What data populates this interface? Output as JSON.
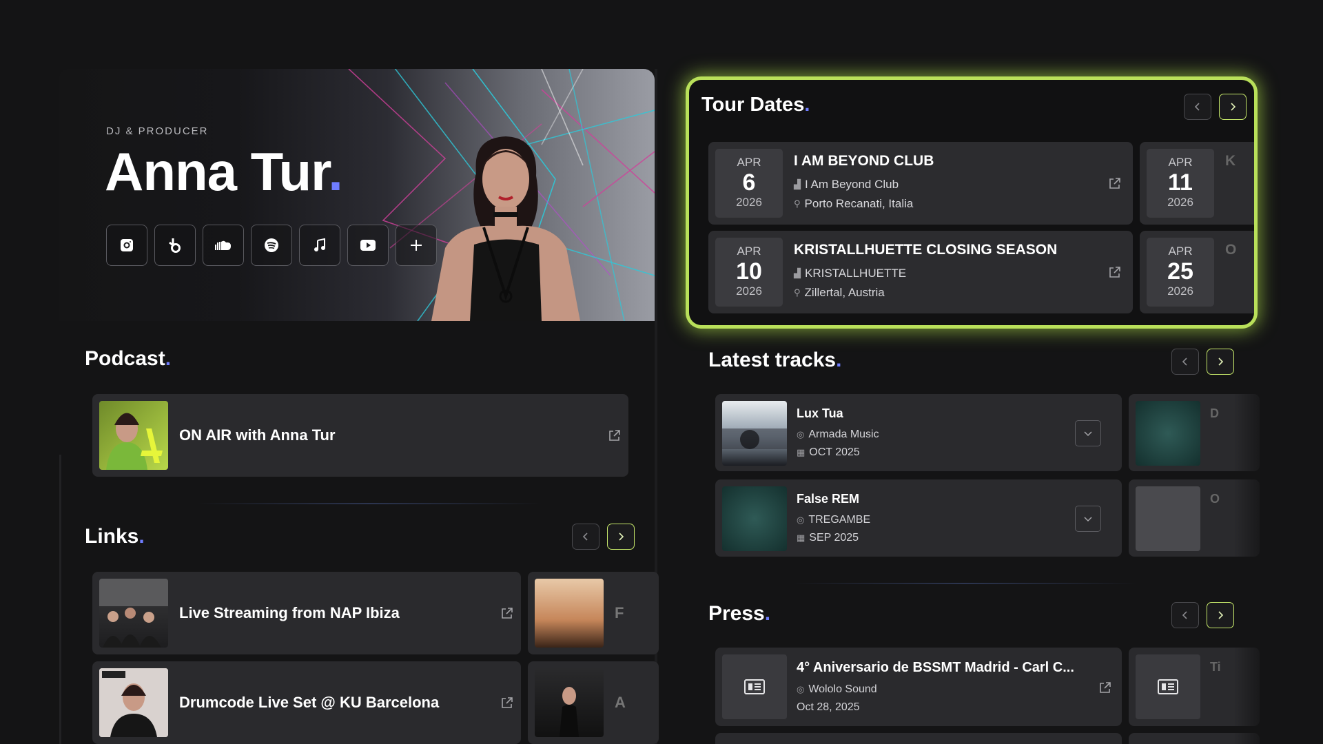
{
  "hero": {
    "eyebrow": "DJ & PRODUCER",
    "name": "Anna Tur",
    "socials": [
      {
        "icon": "instagram-icon"
      },
      {
        "icon": "beatport-icon"
      },
      {
        "icon": "soundcloud-icon"
      },
      {
        "icon": "spotify-icon"
      },
      {
        "icon": "music-note-icon"
      },
      {
        "icon": "youtube-icon"
      },
      {
        "icon": "plus-icon"
      }
    ]
  },
  "podcast": {
    "title": "Podcast",
    "items": [
      {
        "title": "ON AIR with Anna Tur"
      }
    ]
  },
  "links": {
    "title": "Links",
    "items": [
      {
        "title": "Live Streaming from NAP Ibiza"
      },
      {
        "title": "Drumcode Live Set @ KU Barcelona"
      }
    ],
    "peek": [
      "F",
      "A"
    ]
  },
  "tour": {
    "title": "Tour Dates",
    "items": [
      {
        "month": "APR",
        "day": "6",
        "year": "2026",
        "name": "I AM BEYOND CLUB",
        "venue": "I Am Beyond Club",
        "location": "Porto Recanati, Italia"
      },
      {
        "month": "APR",
        "day": "10",
        "year": "2026",
        "name": "KRISTALLHUETTE CLOSING SEASON",
        "venue": "KRISTALLHUETTE",
        "location": "Zillertal, Austria"
      }
    ],
    "peek": [
      {
        "month": "APR",
        "day": "11",
        "year": "2026",
        "letter": "K"
      },
      {
        "month": "APR",
        "day": "25",
        "year": "2026",
        "letter": "O"
      }
    ]
  },
  "tracks": {
    "title": "Latest tracks",
    "items": [
      {
        "title": "Lux Tua",
        "label": "Armada Music",
        "date": "OCT 2025"
      },
      {
        "title": "False REM",
        "label": "TREGAMBE",
        "date": "SEP 2025"
      }
    ],
    "peek": [
      "D",
      "O"
    ]
  },
  "press": {
    "title": "Press",
    "items": [
      {
        "title": "4° Aniversario de BSSMT Madrid - Carl C...",
        "source": "Wololo Sound",
        "date": "Oct 28, 2025"
      }
    ],
    "peek": [
      "Ti"
    ]
  },
  "colors": {
    "accent": "#6f7dff",
    "highlight": "#b9e05a"
  }
}
